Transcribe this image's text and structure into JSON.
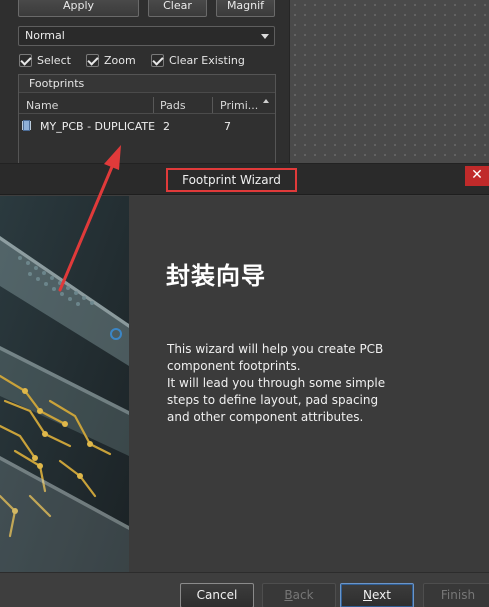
{
  "panel": {
    "buttons": {
      "apply": "Apply",
      "clear": "Clear",
      "magnify": "Magnif"
    },
    "mode_select": {
      "value": "Normal"
    },
    "checkboxes": {
      "select": {
        "label": "Select",
        "checked": true
      },
      "zoom": {
        "label": "Zoom",
        "checked": true
      },
      "clear_existing": {
        "label": "Clear Existing",
        "checked": true
      }
    },
    "footprints": {
      "title": "Footprints",
      "columns": {
        "name": "Name",
        "pads": "Pads",
        "primitives": "Primi..."
      },
      "rows": [
        {
          "name": "MY_PCB - DUPLICATE",
          "pads": "2",
          "primitives": "7"
        }
      ]
    }
  },
  "dialog": {
    "title": "Footprint Wizard",
    "close_glyph": "✕",
    "heading": "封装向导",
    "description_lines": [
      "This wizard will help you create PCB",
      "component footprints.",
      "It will lead you through some simple",
      "steps to define layout, pad spacing",
      "and other component attributes."
    ],
    "buttons": {
      "cancel": "Cancel",
      "back_first": "B",
      "back_rest": "ack",
      "next_first": "N",
      "next_rest": "ext",
      "finish": "Finish"
    }
  },
  "colors": {
    "annotation_red": "#e03a3a",
    "close_red": "#c02a2a",
    "dialog_bg": "#3b3b3b",
    "copper": "#c9a23a"
  },
  "icons": {
    "footprint_row": "footprint-chip-icon",
    "dropdown": "chevron-down-icon",
    "close": "close-icon",
    "sort": "sort-ascending-icon"
  }
}
